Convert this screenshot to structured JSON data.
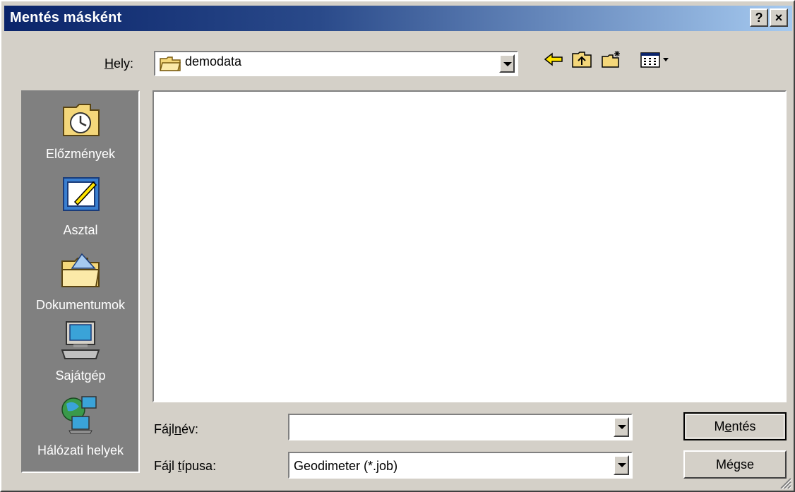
{
  "dialog": {
    "title": "Mentés másként",
    "help_button": "?",
    "close_button": "×"
  },
  "location": {
    "label_accel": "H",
    "label_rest": "ely:",
    "value": "demodata"
  },
  "toolbar": {
    "icons": [
      "back-icon",
      "up-folder-icon",
      "new-folder-icon",
      "view-menu-icon"
    ]
  },
  "places": [
    {
      "label": "Előzmények",
      "icon": "history-icon"
    },
    {
      "label": "Asztal",
      "icon": "desktop-icon"
    },
    {
      "label": "Dokumentumok",
      "icon": "documents-icon"
    },
    {
      "label": "Sajátgép",
      "icon": "my-computer-icon"
    },
    {
      "label": "Hálózati helyek",
      "icon": "network-places-icon"
    }
  ],
  "filename": {
    "label_pre": "Fájl",
    "label_accel": "n",
    "label_post": "év:",
    "value": ""
  },
  "filetype": {
    "label_pre": "Fájl ",
    "label_accel": "t",
    "label_post": "ípusa:",
    "value": "Geodimeter (*.job)"
  },
  "buttons": {
    "save_pre": "M",
    "save_accel": "e",
    "save_post": "ntés",
    "cancel": "Mégse"
  }
}
